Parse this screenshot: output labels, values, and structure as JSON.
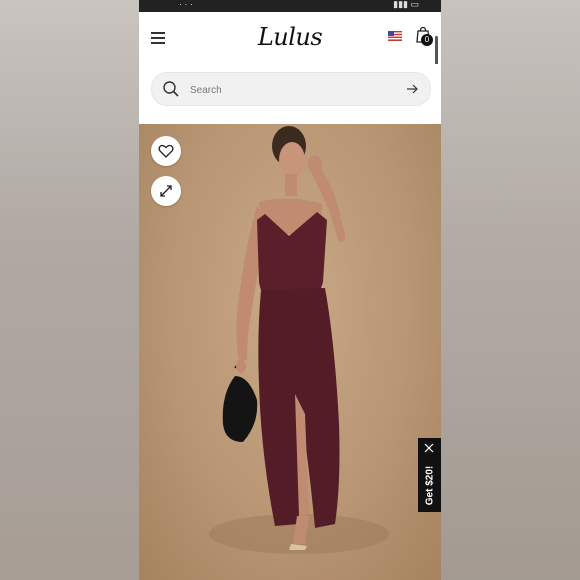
{
  "app": {
    "logo_text": "Lulus",
    "cart_count": "0"
  },
  "search": {
    "placeholder": "Search"
  },
  "promo": {
    "label": "Get $20!"
  },
  "colors": {
    "status_bar": "#222222",
    "dress": "#5a1f2b",
    "backdrop": "#b99674",
    "promo_bg": "#111111"
  },
  "icons": [
    "menu-icon",
    "flag-icon",
    "shopping-bag-icon",
    "search-icon",
    "arrow-right-icon",
    "heart-icon",
    "expand-icon",
    "close-icon"
  ]
}
